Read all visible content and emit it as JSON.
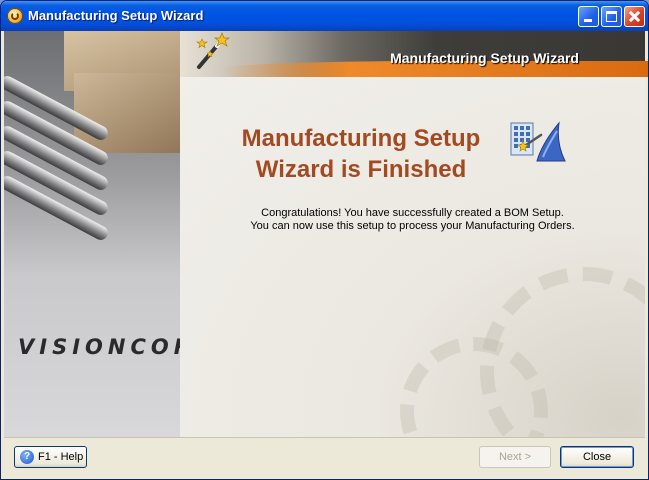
{
  "window": {
    "title": "Manufacturing Setup Wizard",
    "controls": {
      "minimize": "minimize-icon",
      "maximize": "maximize-icon",
      "close": "close-icon"
    }
  },
  "sidebar": {
    "brand_vision": "VISION",
    "brand_core": "CORE"
  },
  "banner": {
    "title": "Manufacturing Setup Wizard",
    "icon": "magic-wand-icon"
  },
  "main": {
    "heading_line1": "Manufacturing Setup",
    "heading_line2": "Wizard is Finished",
    "icon": "wizard-finish-icon",
    "message_line1": "Congratulations! You have successfully created a BOM Setup.",
    "message_line2": "You can now use this setup to process your Manufacturing Orders."
  },
  "footer": {
    "help_label": "F1 - Help",
    "next_label": "Next >",
    "next_enabled": false,
    "close_label": "Close"
  },
  "colors": {
    "titlebar": "#0054E3",
    "heading": "#A24A22",
    "window_bg": "#ECE9D8",
    "banner_accent": "#EF8A2A"
  }
}
